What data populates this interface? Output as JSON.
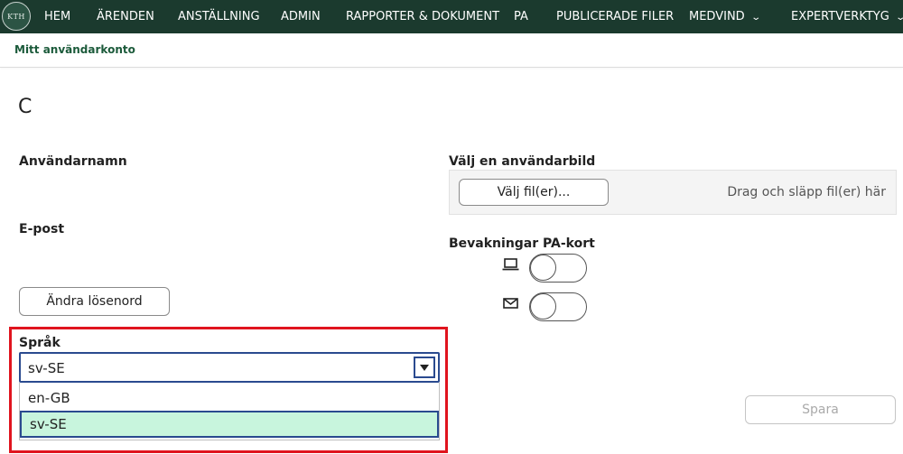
{
  "nav": {
    "logo_text": "KTH",
    "items": [
      {
        "label": "HEM"
      },
      {
        "label": "ÄRENDEN"
      },
      {
        "label": "ANSTÄLLNING"
      },
      {
        "label": "ADMIN"
      },
      {
        "label": "RAPPORTER & DOKUMENT"
      },
      {
        "label": "PA"
      },
      {
        "label": "PUBLICERADE FILER"
      },
      {
        "label": "MEDVIND"
      },
      {
        "label": "EXPERTVERKTYG"
      }
    ]
  },
  "subheader": {
    "title": "Mitt användarkonto"
  },
  "profile": {
    "initial": "C",
    "username_label": "Användarnamn",
    "email_label": "E-post",
    "change_password_label": "Ändra lösenord"
  },
  "avatar_upload": {
    "label": "Välj en användarbild",
    "button_label": "Välj fil(er)...",
    "drop_text": "Drag och släpp fil(er) här"
  },
  "pa_watch": {
    "label": "Bevakningar PA-kort",
    "toggles": [
      {
        "icon": "laptop-icon",
        "on": false
      },
      {
        "icon": "mail-icon",
        "on": false
      }
    ]
  },
  "language": {
    "label": "Språk",
    "selected": "sv-SE",
    "options": [
      {
        "label": "en-GB"
      },
      {
        "label": "sv-SE"
      }
    ]
  },
  "actions": {
    "save_label": "Spara"
  },
  "colors": {
    "nav_bg": "#1b3a2e",
    "subheader_text": "#1b5a3a",
    "highlight_border": "#e0141e",
    "selected_option_bg": "#c8f5dd",
    "select_border": "#2a4a8f"
  }
}
